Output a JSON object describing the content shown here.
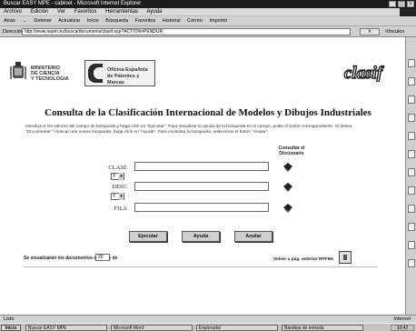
{
  "window": {
    "title": "Buscar EASY MPE - cabinet - Microsoft Internet Explorer",
    "controls": [
      "_",
      "□",
      "×"
    ]
  },
  "menubar": [
    "Archivo",
    "Edición",
    "Ver",
    "Favoritos",
    "Herramientas",
    "Ayuda"
  ],
  "toolbar": [
    "Atrás",
    "→",
    "Detener",
    "Actualizar",
    "Inicio",
    "Búsqueda",
    "Favoritos",
    "Historial",
    "Correo",
    "Imprimir"
  ],
  "address": {
    "label": "Dirección",
    "value": "http://www.oepm.es/busca/documents/clasif.asp?ACTION=PENDUR",
    "go_label": "Ir",
    "links_label": "Vínculos"
  },
  "header": {
    "ministry_lines": [
      "MINISTERIO",
      "DE CIENCIA",
      "Y TECNOLOGIA"
    ],
    "oepm_lines": [
      "Oficina Española",
      "de Patentes y Marcas"
    ],
    "clasif_logo_text": "clasif"
  },
  "page": {
    "title": "Consulta de la Clasificación Internacional de Modelos y Dibujos Industriales",
    "instructions": "Introduzca los valores del campo de búsqueda y haga click en \"Ejecutar\". Para visualizar la ayuda de la búsqueda en el campo, pulse el botón correspondiente. Si desea \"Documentar\" / buscar una nueva búsqueda, haga click en \"Ayuda\". Para consultar la búsqueda, seleccione el botón \"Anular\".",
    "consultar_header": [
      "Consultar el",
      "Diccionario"
    ]
  },
  "form": {
    "fields": [
      {
        "label": "CLASE",
        "value": "",
        "operator": "Y"
      },
      {
        "label": "DESC",
        "value": "",
        "operator": "Y"
      },
      {
        "label": "FILA",
        "value": "",
        "operator": ""
      }
    ]
  },
  "buttons": {
    "execute": "Ejecutar",
    "help": "Ayuda",
    "cancel": "Anular"
  },
  "footer": {
    "docs_label": "Se visualizarán los documentos en lotes de",
    "docs_value": "20",
    "back_label": "Volver a pág. anterior RPFMs"
  },
  "statusbar": {
    "left": "Listo",
    "zone": "Internet"
  },
  "taskbar": {
    "start": "Inicio",
    "tasks": [
      "Buscar EASY MPE",
      "Microsoft Word",
      "Explorador",
      "Bandeja de entrada"
    ],
    "clock": "10:42"
  },
  "colors": {
    "page_bg": "#ffffff",
    "chrome": "#d2d2d2",
    "titlebar": "#1c1c1c"
  }
}
